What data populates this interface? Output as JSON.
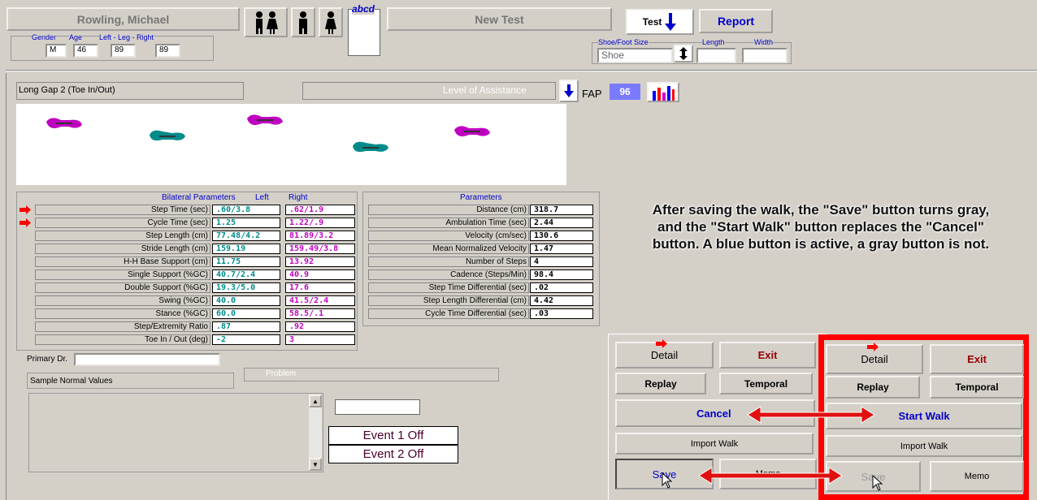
{
  "patient": {
    "name": "Rowling, Michael",
    "gender_label": "Gender",
    "gender": "M",
    "age_label": "Age",
    "age": "46",
    "leg_label": "Left - Leg - Right",
    "leg_left": "89",
    "leg_right": "89"
  },
  "toolbar": {
    "abcd": "abcd",
    "new_test": "New Test",
    "test": "Test",
    "report": "Report",
    "shoe_label": "Shoe/Foot Size",
    "shoe_value": "Shoe",
    "length_label": "Length",
    "width_label": "Width"
  },
  "test_title": "Long Gap 2 (Toe In/Out)",
  "assist_label": "Level of Assistance",
  "fap_label": "FAP",
  "fap_value": "96",
  "bilateral": {
    "title": "Bilateral  Parameters",
    "left_h": "Left",
    "right_h": "Right",
    "rows": [
      {
        "label": "Step Time (sec)",
        "left": ".60/3.8",
        "right": ".62/1.9"
      },
      {
        "label": "Cycle Time (sec)",
        "left": "1.25",
        "right": "1.22/.9"
      },
      {
        "label": "Step Length (cm)",
        "left": "77.48/4.2",
        "right": "81.89/3.2"
      },
      {
        "label": "Stride Length (cm)",
        "left": "159.19",
        "right": "159.49/3.8"
      },
      {
        "label": "H-H Base Support (cm)",
        "left": "11.75",
        "right": "13.92"
      },
      {
        "label": "Single Support (%GC)",
        "left": "40.7/2.4",
        "right": "40.9"
      },
      {
        "label": "Double Support (%GC)",
        "left": "19.3/5.0",
        "right": "17.6"
      },
      {
        "label": "Swing (%GC)",
        "left": "40.0",
        "right": "41.5/2.4"
      },
      {
        "label": "Stance (%GC)",
        "left": "60.0",
        "right": "58.5/.1"
      },
      {
        "label": "Step/Extremity Ratio",
        "left": ".87",
        "right": ".92"
      },
      {
        "label": "Toe In / Out (deg)",
        "left": "-2",
        "right": "3"
      }
    ]
  },
  "parameters": {
    "title": "Parameters",
    "rows": [
      {
        "label": "Distance (cm)",
        "value": "318.7"
      },
      {
        "label": "Ambulation Time (sec)",
        "value": "2.44"
      },
      {
        "label": "Velocity (cm/sec)",
        "value": "130.6"
      },
      {
        "label": "Mean Normalized Velocity",
        "value": "1.47"
      },
      {
        "label": "Number of Steps",
        "value": "4"
      },
      {
        "label": "Cadence (Steps/Min)",
        "value": "98.4"
      },
      {
        "label": "Step Time Differential (sec)",
        "value": ".02"
      },
      {
        "label": "Step Length Differential (cm)",
        "value": "4.42"
      },
      {
        "label": "Cycle Time Differential (sec)",
        "value": ".03"
      }
    ]
  },
  "annotation": "After saving the walk, the \"Save\" button turns gray, and the \"Start Walk\" button replaces the \"Cancel\" button. A blue button is active, a gray button is not.",
  "primary_dr_label": "Primary Dr.",
  "normals_label": "Sample Normal Values",
  "problem_label": "Problem",
  "event1": "Event 1 Off",
  "event2": "Event 2 Off",
  "panel_left": {
    "detail": "Detail",
    "exit": "Exit",
    "replay": "Replay",
    "temporal": "Temporal",
    "cancel": "Cancel",
    "import": "Import Walk",
    "save": "Save",
    "memo": "Memo"
  },
  "panel_right": {
    "detail": "Detail",
    "exit": "Exit",
    "replay": "Replay",
    "temporal": "Temporal",
    "start": "Start Walk",
    "import": "Import Walk",
    "save": "Save",
    "memo": "Memo"
  },
  "colors": {
    "accent": "#0000cc",
    "highlight": "#ff0000",
    "left_foot": "#c000c0",
    "right_foot": "#008b8b"
  }
}
